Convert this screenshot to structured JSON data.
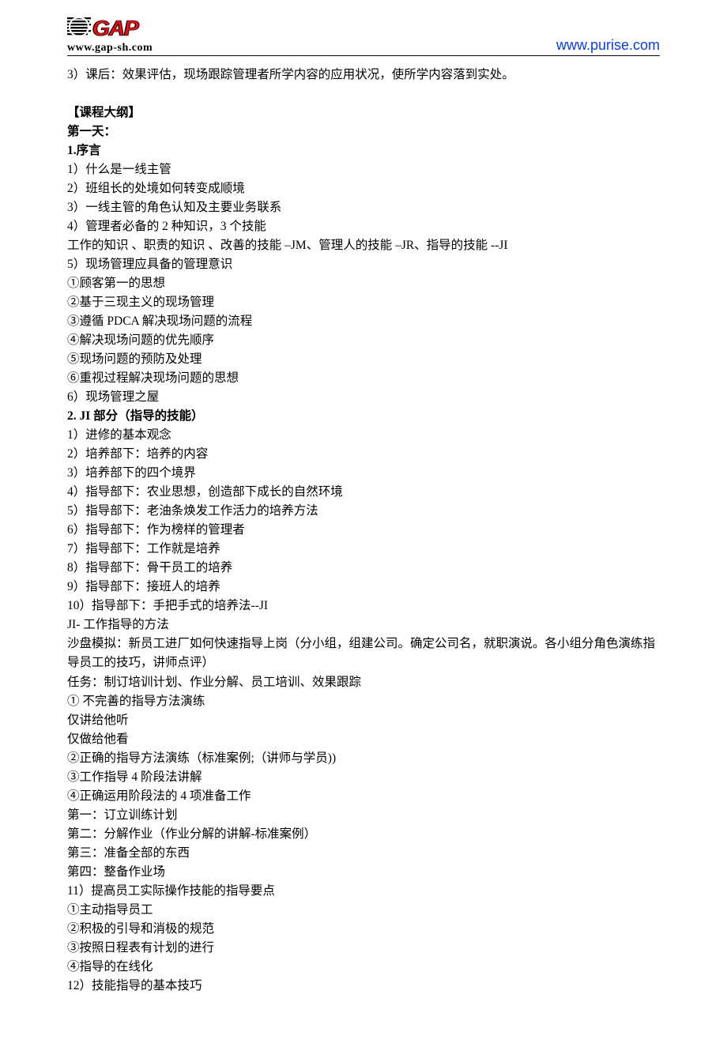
{
  "header": {
    "logo_text": "GAP",
    "logo_url": "www.gap-sh.com",
    "right_url": "www.purise.com"
  },
  "content": {
    "pre_line": "3）课后：效果评估，现场跟踪管理者所学内容的应用状况，使所学内容落到实处。",
    "outline_title": "【课程大纲】",
    "day1": " 第一天：",
    "s1_title": "1.序言",
    "s1": [
      "1）什么是一线主管",
      "2）班组长的处境如何转变成顺境",
      "3）一线主管的角色认知及主要业务联系",
      "4）管理者必备的 2 种知识，3 个技能",
      "工作的知识 、职责的知识 、改善的技能 –JM、管理人的技能 –JR、指导的技能 --JI",
      "5）现场管理应具备的管理意识",
      "①顾客第一的思想",
      "②基于三现主义的现场管理",
      "③遵循 PDCA 解决现场问题的流程",
      "④解决现场问题的优先顺序",
      "⑤现场问题的预防及处理",
      "⑥重视过程解决现场问题的思想",
      "6）现场管理之屋"
    ],
    "s2_title": "2. JI 部分（指导的技能）",
    "s2": [
      "1）进修的基本观念",
      "2）培养部下：培养的内容",
      "3）培养部下的四个境界",
      "4）指导部下：农业思想，创造部下成长的自然环境",
      "5）指导部下：老油条焕发工作活力的培养方法",
      "6）指导部下：作为榜样的管理者",
      "7）指导部下：工作就是培养",
      "8）指导部下：骨干员工的培养",
      "9）指导部下：接班人的培养",
      "10）指导部下：手把手式的培养法--JI",
      "JI- 工作指导的方法",
      "沙盘模拟：新员工进厂如何快速指导上岗（分小组，组建公司。确定公司名，就职演说。各小组分角色演练指导员工的技巧，讲师点评）",
      "任务：制订培训计划、作业分解、员工培训、效果跟踪",
      " ① 不完善的指导方法演练",
      "仅讲给他听",
      "仅做给他看",
      "②正确的指导方法演练（标准案例;（讲师与学员))",
      "③工作指导 4 阶段法讲解",
      "④正确运用阶段法的 4 项准备工作",
      "第一：订立训练计划",
      "第二：分解作业（作业分解的讲解-标准案例）",
      "第三：准备全部的东西",
      "第四：整备作业场",
      "11）提高员工实际操作技能的指导要点",
      "①主动指导员工",
      "②积极的引导和消极的规范",
      "③按照日程表有计划的进行",
      "④指导的在线化",
      "12）技能指导的基本技巧"
    ]
  }
}
